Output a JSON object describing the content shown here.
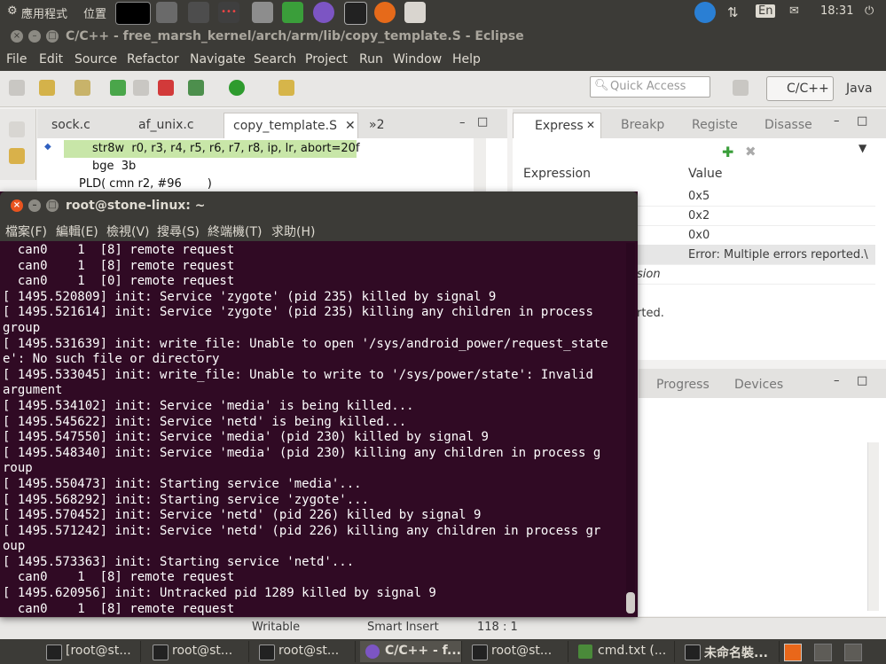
{
  "top_panel": {
    "app_menu": "應用程式",
    "places": "位置",
    "input_method": "En",
    "clock": "18:31"
  },
  "eclipse": {
    "title": "C/C++ - free_marsh_kernel/arch/arm/lib/copy_template.S - Eclipse",
    "menu": [
      "File",
      "Edit",
      "Source",
      "Refactor",
      "Navigate",
      "Search",
      "Project",
      "Run",
      "Window",
      "Help"
    ],
    "quick_access_placeholder": "Quick Access",
    "perspectives": [
      "C/C++",
      "Java"
    ],
    "editor_tabs": [
      "sock.c",
      "af_unix.c",
      "copy_template.S",
      "»2"
    ],
    "code_lines": [
      "str8w  r0, r3, r4, r5, r6, r7, r8, ip, lr, abort=20f",
      "bge  3b",
      "PLD( cmn r2, #96       )"
    ],
    "view_tabs": [
      "Express",
      "Breakp",
      "Registe",
      "Disasse"
    ],
    "expressions": {
      "columns": [
        "Expression",
        "Value"
      ],
      "rows": [
        {
          "expr": "",
          "value": "0x5"
        },
        {
          "expr": "",
          "value": "0x2"
        },
        {
          "expr": "",
          "value": "0x0"
        },
        {
          "expr": "",
          "value": "Error: Multiple errors reported.\\"
        },
        {
          "expr": "sion",
          "value": ""
        }
      ],
      "detail_text": "rted."
    },
    "lower_view_tabs": [
      "Progress",
      "Devices"
    ],
    "status": {
      "mode": "Writable",
      "insert": "Smart Insert",
      "position": "118 : 1"
    }
  },
  "terminal": {
    "title": "root@stone-linux: ~",
    "menu": [
      "檔案(F)",
      "編輯(E)",
      "檢視(V)",
      "搜尋(S)",
      "終端機(T)",
      "求助(H)"
    ],
    "lines": [
      "  can0    1  [8] remote request",
      "  can0    1  [8] remote request",
      "  can0    1  [0] remote request",
      "[ 1495.520809] init: Service 'zygote' (pid 235) killed by signal 9",
      "[ 1495.521614] init: Service 'zygote' (pid 235) killing any children in process",
      "group",
      "[ 1495.531639] init: write_file: Unable to open '/sys/android_power/request_state",
      "e': No such file or directory",
      "[ 1495.533045] init: write_file: Unable to write to '/sys/power/state': Invalid",
      "argument",
      "[ 1495.534102] init: Service 'media' is being killed...",
      "[ 1495.545622] init: Service 'netd' is being killed...",
      "[ 1495.547550] init: Service 'media' (pid 230) killed by signal 9",
      "[ 1495.548340] init: Service 'media' (pid 230) killing any children in process g",
      "roup",
      "[ 1495.550473] init: Starting service 'media'...",
      "[ 1495.568292] init: Starting service 'zygote'...",
      "[ 1495.570452] init: Service 'netd' (pid 226) killed by signal 9",
      "[ 1495.571242] init: Service 'netd' (pid 226) killing any children in process gr",
      "oup",
      "[ 1495.573363] init: Starting service 'netd'...",
      "  can0    1  [8] remote request",
      "[ 1495.620956] init: Untracked pid 1289 killed by signal 9",
      "  can0    1  [8] remote request"
    ]
  },
  "taskbar": {
    "tasks": [
      "[root@st...",
      "root@st...",
      "root@st...",
      "C/C++ - f...",
      "root@st...",
      "cmd.txt (...",
      "未命名裝..."
    ]
  },
  "colors": {
    "terminal_bg": "#300a24",
    "panel_bg": "#3c3b37",
    "highlight_line": "#c8e6a8"
  }
}
